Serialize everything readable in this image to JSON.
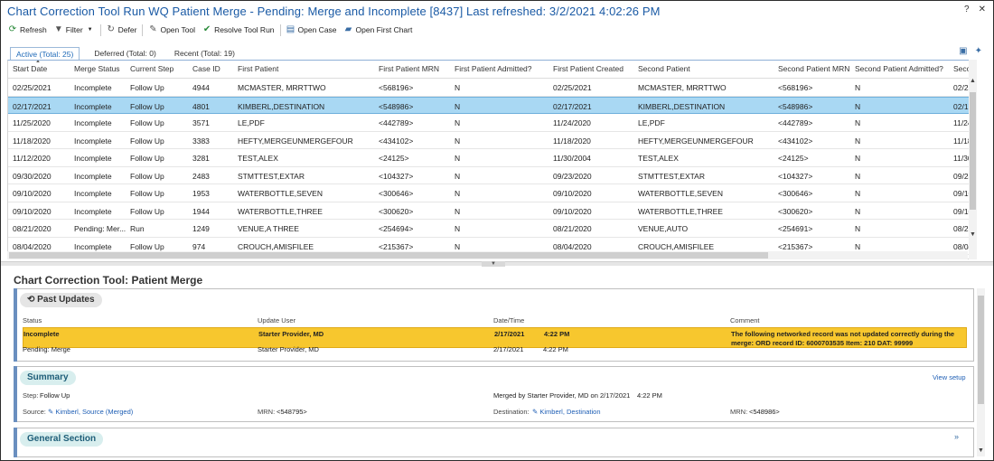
{
  "window": {
    "title": "Chart Correction Tool Run WQ Patient Merge - Pending: Merge and Incomplete [8437] Last refreshed: 3/2/2021 4:02:26 PM",
    "help_icon": "?",
    "close_icon": "✕"
  },
  "toolbar": {
    "refresh": "Refresh",
    "filter": "Filter",
    "defer": "Defer",
    "open_tool": "Open Tool",
    "resolve": "Resolve Tool Run",
    "open_case": "Open Case",
    "open_first_chart": "Open First Chart"
  },
  "tabs": [
    {
      "label": "Active (Total: 25)"
    },
    {
      "label": "Deferred (Total: 0)"
    },
    {
      "label": "Recent (Total: 19)"
    }
  ],
  "grid": {
    "columns": [
      "Start Date",
      "Merge Status",
      "Current Step",
      "Case ID",
      "First Patient",
      "First Patient MRN",
      "First Patient Admitted?",
      "First Patient Created",
      "Second Patient",
      "Second Patient MRN",
      "Second Patient Admitted?",
      "Secon"
    ],
    "rows": [
      [
        "02/25/2021",
        "Incomplete",
        "Follow Up",
        "4944",
        "MCMASTER, MRRTTWO",
        "<568196>",
        "N",
        "02/25/2021",
        "MCMASTER, MRRTTWO",
        "<568196>",
        "N",
        "02/25"
      ],
      [
        "02/17/2021",
        "Incomplete",
        "Follow Up",
        "4801",
        "KIMBERL,DESTINATION",
        "<548986>",
        "N",
        "02/17/2021",
        "KIMBERL,DESTINATION",
        "<548986>",
        "N",
        "02/17/"
      ],
      [
        "11/25/2020",
        "Incomplete",
        "Follow Up",
        "3571",
        "LE,PDF",
        "<442789>",
        "N",
        "11/24/2020",
        "LE,PDF",
        "<442789>",
        "N",
        "11/24/"
      ],
      [
        "11/18/2020",
        "Incomplete",
        "Follow Up",
        "3383",
        "HEFTY,MERGEUNMERGEFOUR",
        "<434102>",
        "N",
        "11/18/2020",
        "HEFTY,MERGEUNMERGEFOUR",
        "<434102>",
        "N",
        "11/18/"
      ],
      [
        "11/12/2020",
        "Incomplete",
        "Follow Up",
        "3281",
        "TEST,ALEX",
        "<24125>",
        "N",
        "11/30/2004",
        "TEST,ALEX",
        "<24125>",
        "N",
        "11/30/"
      ],
      [
        "09/30/2020",
        "Incomplete",
        "Follow Up",
        "2483",
        "STMTTEST,EXTAR",
        "<104327>",
        "N",
        "09/23/2020",
        "STMTTEST,EXTAR",
        "<104327>",
        "N",
        "09/23/"
      ],
      [
        "09/10/2020",
        "Incomplete",
        "Follow Up",
        "1953",
        "WATERBOTTLE,SEVEN",
        "<300646>",
        "N",
        "09/10/2020",
        "WATERBOTTLE,SEVEN",
        "<300646>",
        "N",
        "09/10/"
      ],
      [
        "09/10/2020",
        "Incomplete",
        "Follow Up",
        "1944",
        "WATERBOTTLE,THREE",
        "<300620>",
        "N",
        "09/10/2020",
        "WATERBOTTLE,THREE",
        "<300620>",
        "N",
        "09/10/"
      ],
      [
        "08/21/2020",
        "Pending: Mer...",
        "Run",
        "1249",
        "VENUE,A THREE",
        "<254694>",
        "N",
        "08/21/2020",
        "VENUE,AUTO",
        "<254691>",
        "N",
        "08/21/"
      ],
      [
        "08/04/2020",
        "Incomplete",
        "Follow Up",
        "974",
        "CROUCH,AMISFILEE",
        "<215367>",
        "N",
        "08/04/2020",
        "CROUCH,AMISFILEE",
        "<215367>",
        "N",
        "08/04/"
      ]
    ]
  },
  "detail": {
    "title": "Chart Correction Tool: Patient Merge",
    "past_updates": {
      "header": "Past Updates",
      "col_status": "Status",
      "col_user": "Update User",
      "col_date": "Date/Time",
      "col_comment": "Comment",
      "rows": [
        {
          "status": "Incomplete",
          "user": "Starter Provider, MD",
          "date": "2/17/2021",
          "time": "4:22 PM",
          "comment1": "The following networked record was not updated correctly during the",
          "comment2": "merge: ORD record ID: 6000703535 Item: 210 DAT: 99999"
        },
        {
          "status": "Pending: Merge",
          "user": "Starter Provider, MD",
          "date": "2/17/2021",
          "time": "4:22 PM",
          "comment1": "",
          "comment2": ""
        }
      ]
    },
    "summary": {
      "header": "Summary",
      "view_setup": "View setup",
      "step_label": "Step:",
      "step_value": "Follow Up",
      "merged_by": "Merged by Starter Provider, MD on 2/17/2021",
      "merged_time": "4:22 PM",
      "source_label": "Source:",
      "source_value": "Kimberl, Source (Merged)",
      "mrn_label": "MRN:",
      "source_mrn": "<548795>",
      "destination_label": "Destination:",
      "destination_value": "Kimberl, Destination",
      "destination_mrn": "<548986>"
    },
    "general": {
      "header": "General Section"
    }
  }
}
